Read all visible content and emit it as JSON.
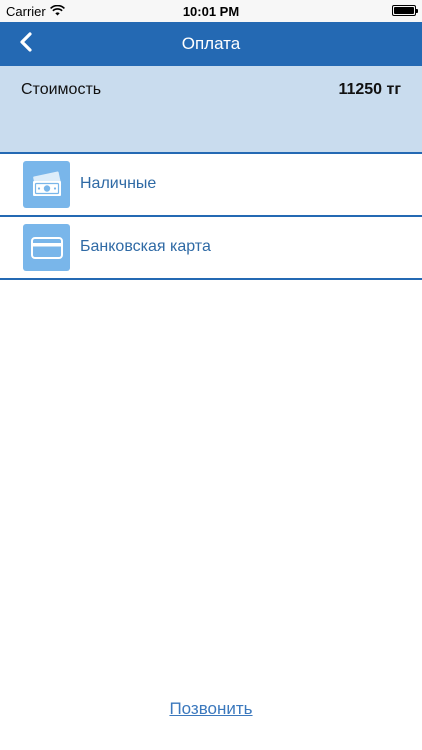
{
  "status_bar": {
    "carrier": "Carrier",
    "time": "10:01 PM"
  },
  "nav": {
    "title": "Оплата"
  },
  "price": {
    "label": "Стоимость",
    "value": "11250 тг"
  },
  "payment_options": [
    {
      "label": "Наличные",
      "icon": "cash-icon"
    },
    {
      "label": "Банковская карта",
      "icon": "credit-card-icon"
    }
  ],
  "footer": {
    "call_label": "Позвонить"
  },
  "colors": {
    "nav_bar": "#2469b3",
    "price_panel": "#c9dcee",
    "icon_tile": "#79b6ea",
    "option_text": "#2f6aa5",
    "link_text": "#3b78bd"
  }
}
